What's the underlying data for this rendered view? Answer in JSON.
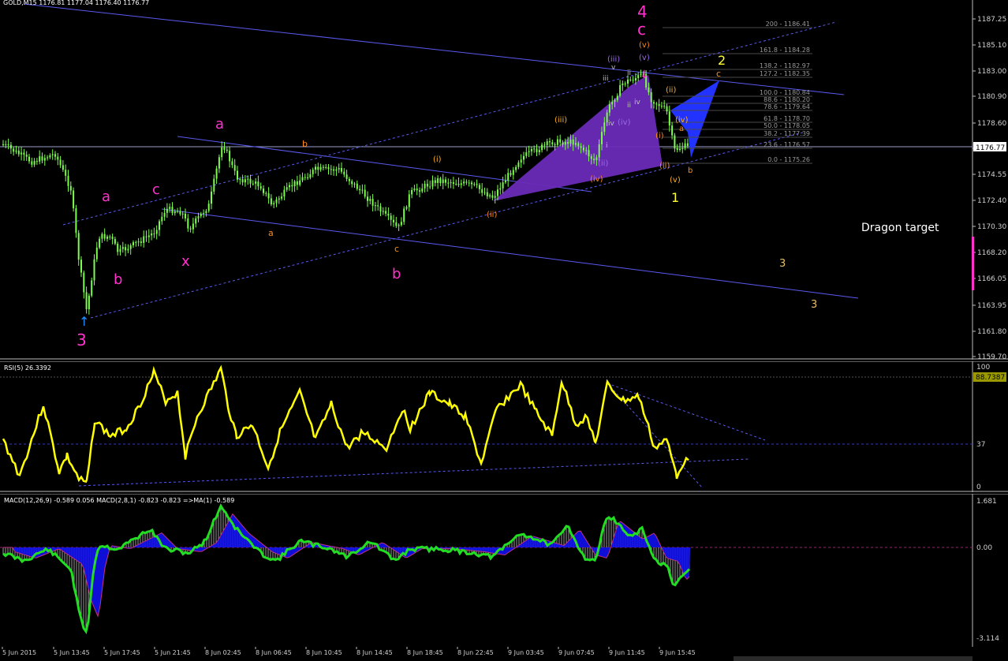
{
  "main": {
    "symbol": "GOLD,M15",
    "ohlc": "1176.81 1177.04 1176.40 1176.77",
    "current_price": "1176.77",
    "price_ticks": [
      "1187.25",
      "1185.10",
      "1183.00",
      "1180.90",
      "1178.60",
      "1176.57",
      "1174.55",
      "1172.40",
      "1170.30",
      "1168.20",
      "1166.05",
      "1163.95",
      "1161.80",
      "1159.70"
    ],
    "fib_levels": [
      "200 - 1186.41",
      "161.8 - 1184.28",
      "138.2 - 1182.97",
      "127.2 - 1182.35",
      "100.0 - 1180.84",
      "88.6 - 1180.20",
      "78.6 - 1179.64",
      "61.8 - 1178.70",
      "50.0 - 1178.05",
      "38.2 - 1177.39",
      "23.6 - 1176.57",
      "0.0 - 1175.26"
    ],
    "waves": {
      "w3": "3",
      "w4": "4",
      "c_top": "c",
      "a_left": "a",
      "b_left": "b",
      "c_left": "c",
      "x_left": "x",
      "a_mid": "a",
      "b_mid": "b",
      "small_b": "b",
      "small_a": "a",
      "small_c": "c",
      "i1": "(i)",
      "ii1": "(ii)",
      "iii1": "(iii)",
      "iv1": "(iv)",
      "v_top": "(v)",
      "iii_p": "(iii)",
      "iv_p": "(iv)",
      "ii_p": "(ii)",
      "ii_r": "(ii)",
      "iv_r": "(iv)",
      "i_r": "(i)",
      "ii_r2": "(ii)",
      "v_r": "(v)",
      "a_r": "a",
      "b_r": "b",
      "c_r": "c",
      "one": "1",
      "two": "2",
      "three_a": "3",
      "three_b": "3",
      "small_v": "v",
      "small_iii": "iii",
      "small_ii": "ii",
      "small_iv": "iv",
      "small_iii2": "iii",
      "small_iv2": "iv",
      "small_i": "i",
      "small_ii2": "ii",
      "small_v2": "v",
      "small_i2": "(i)"
    },
    "dragon_label": "Dragon target"
  },
  "rsi": {
    "title": "RSI(5) 26.3392",
    "ticks": [
      "100",
      "37",
      "0"
    ],
    "value_badge": "88.7387"
  },
  "macd": {
    "title": "MACD(12,26,9) -0.589 0.056  MACD(2,8,1) -0.823 -0.823  =>MA(1) -0.589",
    "ticks": [
      "1.681",
      "0.00",
      "-3.114"
    ]
  },
  "time_axis": [
    "5 Jun 2015",
    "5 Jun 13:45",
    "5 Jun 17:45",
    "5 Jun 21:45",
    "8 Jun 02:45",
    "8 Jun 06:45",
    "8 Jun 10:45",
    "8 Jun 14:45",
    "8 Jun 18:45",
    "8 Jun 22:45",
    "9 Jun 03:45",
    "9 Jun 07:45",
    "9 Jun 11:45",
    "9 Jun 15:45"
  ],
  "colors": {
    "bg": "#000000",
    "candle": "#7CFC4C",
    "pink": "#FF33CC",
    "yellow": "#FFFF33",
    "orange": "#FF8C1A",
    "blue_line": "#5A5AF0",
    "violet": "#6A2BB8",
    "dragon": "#2233FF",
    "rsi": "#FFFF00",
    "macd_green": "#22DD22",
    "macd_blue": "#1010EE",
    "grid": "#1C1C8C"
  }
}
